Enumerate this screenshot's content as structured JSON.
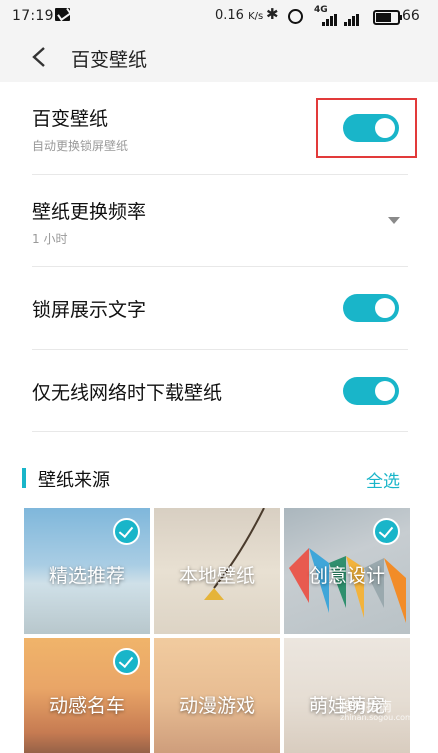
{
  "status_bar": {
    "time": "17:19",
    "speed_value": "0.16",
    "speed_unit": "K/s",
    "signal_label": "4G",
    "battery": "66",
    "battery_level": 0.66
  },
  "header": {
    "title": "百变壁纸"
  },
  "settings": {
    "wallpaper_toggle": {
      "label": "百变壁纸",
      "sub": "自动更换锁屏壁纸",
      "on": true
    },
    "frequency": {
      "label": "壁纸更换频率",
      "value": "1 小时"
    },
    "show_text": {
      "label": "锁屏展示文字",
      "on": true
    },
    "wifi_only": {
      "label": "仅无线网络时下载壁纸",
      "on": true
    }
  },
  "source_section": {
    "title": "壁纸来源",
    "select_all": "全选",
    "tiles": [
      {
        "label": "精选推荐",
        "checked": true
      },
      {
        "label": "本地壁纸",
        "checked": false
      },
      {
        "label": "创意设计",
        "checked": true
      },
      {
        "label": "动感名车",
        "checked": true
      },
      {
        "label": "动漫游戏",
        "checked": false
      },
      {
        "label": "萌娃萌宠",
        "checked": false
      }
    ]
  },
  "watermark": {
    "text": "搜狗指南",
    "url": "zhinan.sogou.com"
  },
  "colors": {
    "accent": "#19b5c9",
    "highlight": "#e23a3a"
  }
}
